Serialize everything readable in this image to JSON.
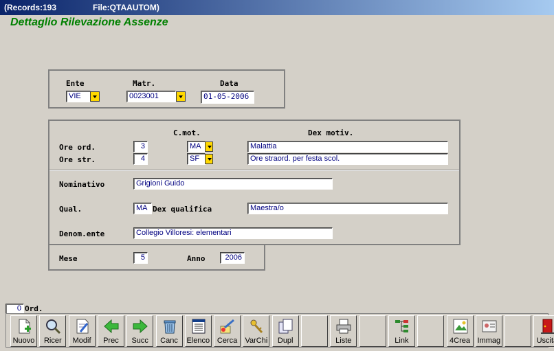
{
  "window": {
    "records": "(Records:193",
    "file": "File:QTAAUTOM)"
  },
  "heading": "Dettaglio Rilevazione Assenze",
  "header_panel": {
    "ente_label": "Ente",
    "ente_value": "VIE",
    "matr_label": "Matr.",
    "matr_value": "0023001",
    "data_label": "Data",
    "data_value": "01-05-2006"
  },
  "detail": {
    "cmot_label": "C.mot.",
    "dexmot_label": "Dex motiv.",
    "ore_ord_label": "Ore ord.",
    "ore_ord_value": "3",
    "ore_ord_code": "MA",
    "ore_ord_dex": "Malattia",
    "ore_str_label": "Ore str.",
    "ore_str_value": "4",
    "ore_str_code": "SF",
    "ore_str_dex": "Ore straord. per festa scol.",
    "nominativo_label": "Nominativo",
    "nominativo_value": "Grigioni Guido",
    "qual_label": "Qual.",
    "qual_value": "MA",
    "dexqual_label": "Dex qualifica",
    "dexqual_value": "Maestra/o",
    "denom_label": "Denom.ente",
    "denom_value": "Collegio Villoresi: elementari"
  },
  "period": {
    "mese_label": "Mese",
    "mese_value": "5",
    "anno_label": "Anno",
    "anno_value": "2006"
  },
  "order": {
    "value": "0",
    "label": "Ord."
  },
  "toolbar": [
    {
      "label": "Nuovo",
      "icon": "new-document-icon"
    },
    {
      "label": "Ricer",
      "icon": "magnifier-icon"
    },
    {
      "label": "Modif",
      "icon": "edit-document-icon"
    },
    {
      "label": "Prec",
      "icon": "arrow-left-icon"
    },
    {
      "label": "Succ",
      "icon": "arrow-right-icon"
    },
    {
      "label": "Canc",
      "icon": "trash-icon"
    },
    {
      "label": "Elenco",
      "icon": "list-icon"
    },
    {
      "label": "Cerca",
      "icon": "search-brush-icon"
    },
    {
      "label": "VarChi",
      "icon": "keys-icon"
    },
    {
      "label": "Dupl",
      "icon": "duplicate-icon"
    },
    {
      "label": "",
      "icon": ""
    },
    {
      "label": "Liste",
      "icon": "printer-icon"
    },
    {
      "label": "",
      "icon": ""
    },
    {
      "label": "Link",
      "icon": "link-tree-icon"
    },
    {
      "label": "",
      "icon": ""
    },
    {
      "label": "4Crea",
      "icon": "create-icon"
    },
    {
      "label": "Immag",
      "icon": "image-card-icon"
    },
    {
      "label": "",
      "icon": ""
    },
    {
      "label": "Uscita",
      "icon": "exit-door-icon"
    }
  ]
}
